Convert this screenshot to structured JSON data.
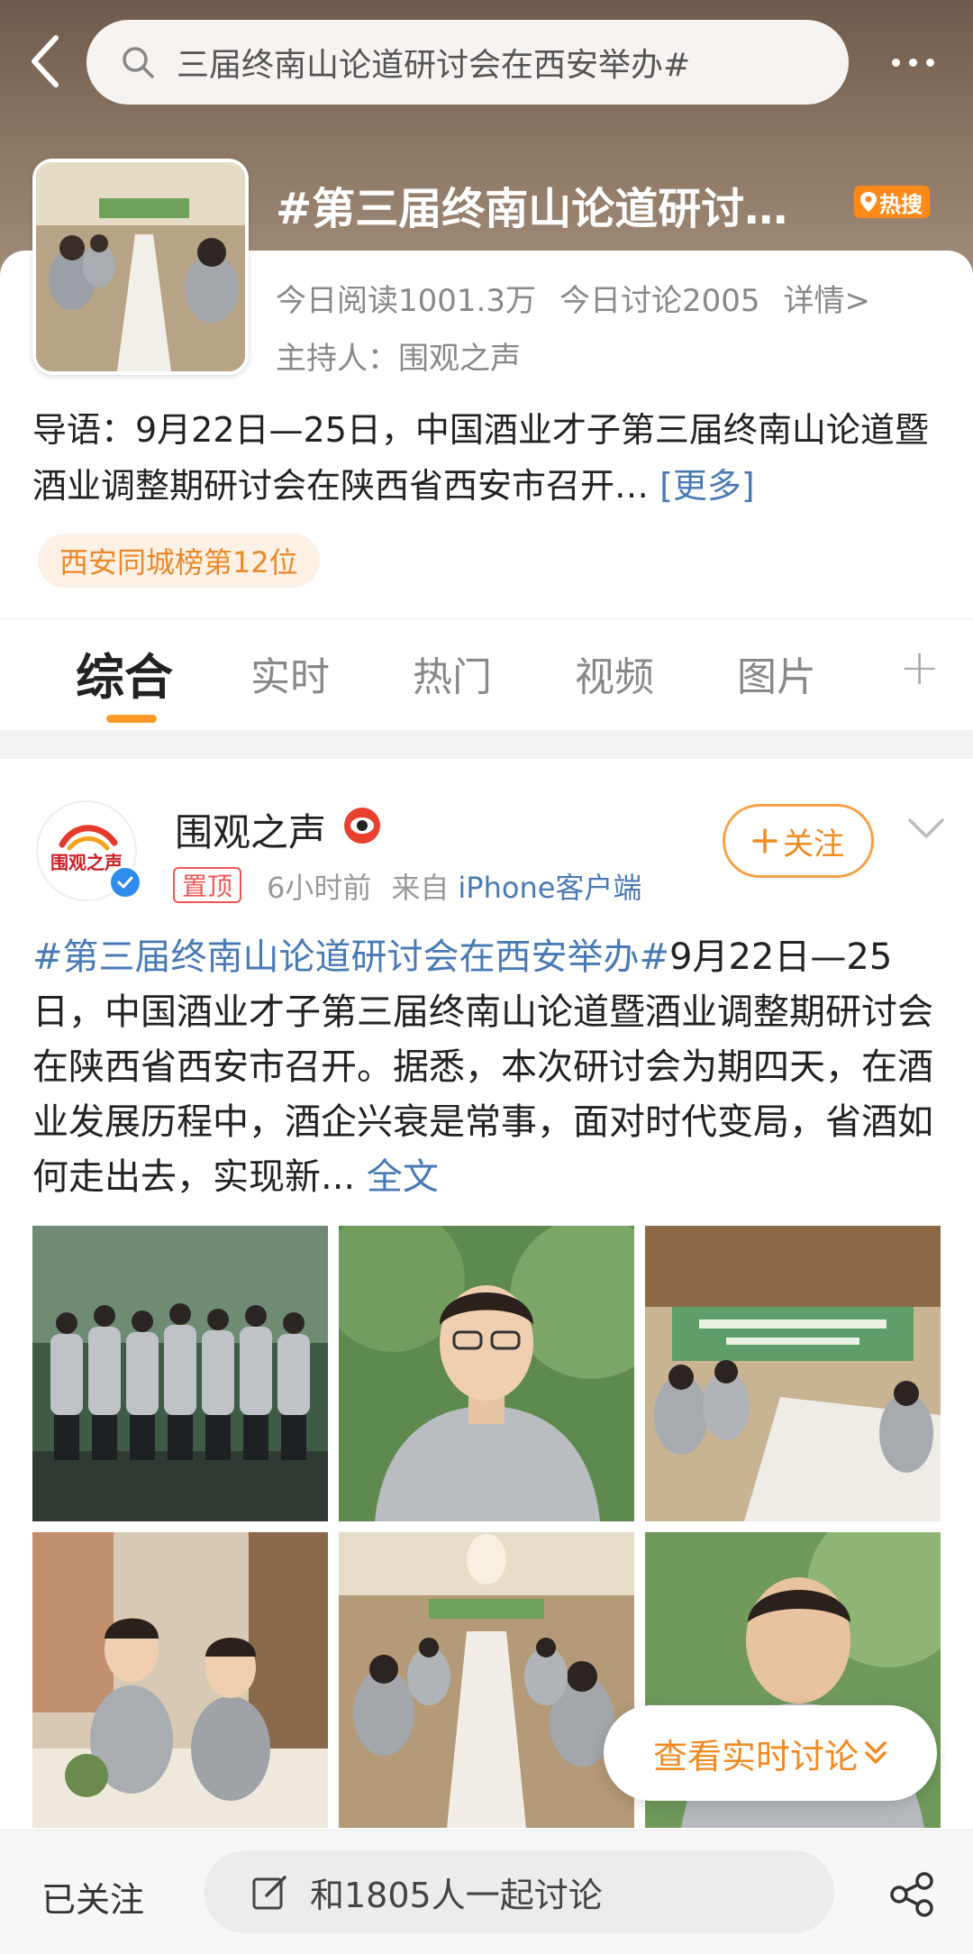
{
  "header": {
    "search_query": "三届终南山论道研讨会在西安举办#"
  },
  "topic": {
    "title": "#第三届终南山论道研讨…",
    "hot_badge": "热搜",
    "reads": "今日阅读1001.3万",
    "discussions": "今日讨论2005",
    "details": "详情>",
    "host": "主持人：围观之声",
    "intro": "导语：9月22日—25日，中国酒业才子第三届终南山论道暨酒业调整期研讨会在陕西省西安市召开…",
    "intro_more": "[更多]",
    "rank": "西安同城榜第12位"
  },
  "tabs": [
    "综合",
    "实时",
    "热门",
    "视频",
    "图片"
  ],
  "post": {
    "avatar_text": "围观之声",
    "username": "围观之声",
    "pinned": "置顶",
    "time": "6小时前",
    "source_prefix": "来自",
    "source": "iPhone客户端",
    "follow": "关注",
    "hashtag": "#第三届终南山论道研讨会在西安举办#",
    "body": "9月22日—25日，中国酒业才子第三届终南山论道暨酒业调整期研讨会在陕西省西安市召开。据悉，本次研讨会为期四天，在酒业发展历程中，酒企兴衰是常事，面对时代变局，省酒如何走出去，实现新...",
    "full_text": "全文"
  },
  "realtime_button": "查看实时讨论",
  "bottom": {
    "followed": "已关注",
    "discuss_placeholder": "和1805人一起讨论"
  },
  "colors": {
    "accent_orange": "#f08a22",
    "link_blue": "#4a7ab3",
    "verified_blue": "#2f8cea",
    "pin_red": "#e55555"
  }
}
